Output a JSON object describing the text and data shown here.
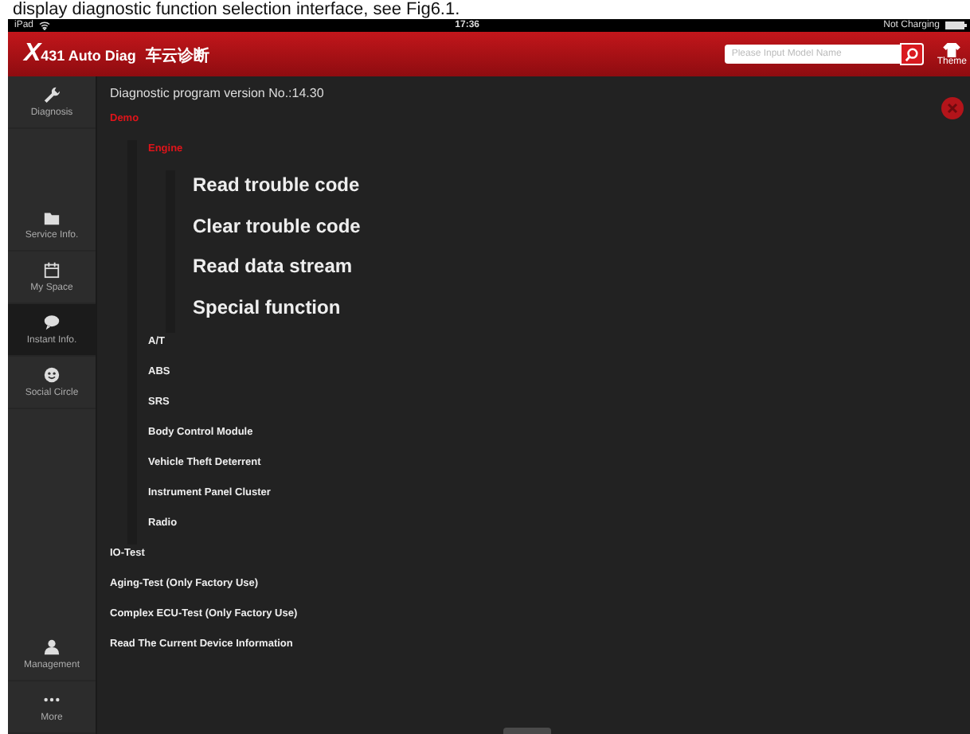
{
  "caption": "display diagnostic function selection interface, see Fig6.1.",
  "status_bar": {
    "device": "iPad",
    "time": "17:36",
    "charging": "Not Charging"
  },
  "header": {
    "logo_mark": "X",
    "logo_text": "431 Auto Diag",
    "logo_cn": "车云诊断",
    "search": {
      "placeholder": "Please Input Model Name"
    },
    "theme_label": "Theme"
  },
  "sidebar": {
    "items": [
      {
        "label": "Diagnosis",
        "selected": false
      },
      {
        "label": "Service Info.",
        "selected": false
      },
      {
        "label": "My Space",
        "selected": false
      },
      {
        "label": "Instant Info.",
        "selected": true
      },
      {
        "label": "Social Circle",
        "selected": false
      },
      {
        "label": "Management",
        "selected": false
      },
      {
        "label": "More",
        "selected": false
      }
    ]
  },
  "content": {
    "version": "Diagnostic program version No.:14.30",
    "tree": [
      {
        "label": "Demo",
        "selected": true,
        "expanded": true,
        "children": [
          {
            "label": "Engine",
            "selected": true,
            "expanded": true,
            "children": [
              {
                "label": "Read trouble code"
              },
              {
                "label": "Clear trouble code"
              },
              {
                "label": "Read data stream"
              },
              {
                "label": "Special function"
              }
            ]
          },
          {
            "label": "A/T",
            "selected": false
          },
          {
            "label": "ABS",
            "selected": false
          },
          {
            "label": "SRS",
            "selected": false
          },
          {
            "label": "Body Control Module",
            "selected": false
          },
          {
            "label": "Vehicle Theft Deterrent",
            "selected": false
          },
          {
            "label": "Instrument Panel Cluster",
            "selected": false
          },
          {
            "label": "Radio",
            "selected": false
          }
        ]
      },
      {
        "label": "IO-Test",
        "selected": false
      },
      {
        "label": "Aging-Test (Only Factory Use)",
        "selected": false
      },
      {
        "label": "Complex ECU-Test (Only Factory Use)",
        "selected": false
      },
      {
        "label": "Read The Current Device Information",
        "selected": false
      }
    ]
  }
}
